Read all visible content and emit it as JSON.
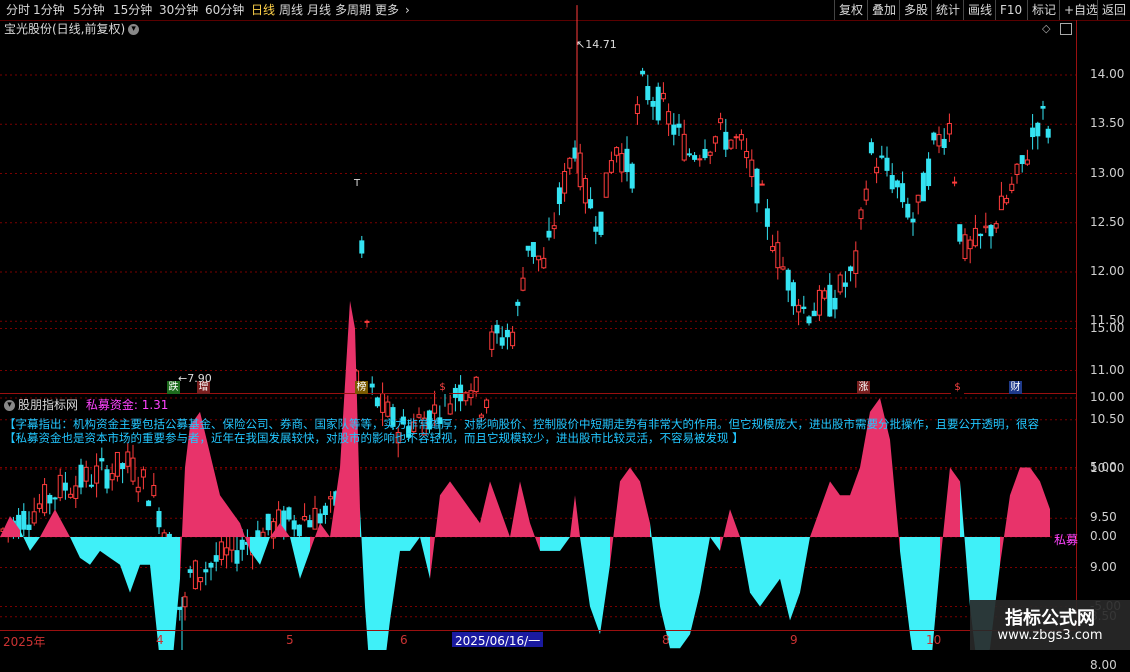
{
  "toolbar": {
    "periods": [
      "分时",
      "1分钟",
      "5分钟",
      "15分钟",
      "30分钟",
      "60分钟",
      "日线",
      "周线",
      "月线",
      "多周期",
      "更多"
    ],
    "actions": [
      "复权",
      "叠加",
      "多股",
      "统计",
      "画线",
      "F10",
      "标记",
      "+自选",
      "返回"
    ]
  },
  "main": {
    "title": "宝光股份(日线,前复权)",
    "high_label": "14.71",
    "low_label": "7.90",
    "marker_t": "T"
  },
  "price_axis": [
    "14.00",
    "13.50",
    "13.00",
    "12.50",
    "12.00",
    "11.50",
    "11.00",
    "10.50",
    "10.00",
    "9.50",
    "9.00",
    "8.50",
    "8.00"
  ],
  "events": [
    {
      "text": "跌",
      "color": "#1d6b1d"
    },
    {
      "text": "增",
      "color": "#7a1f1f"
    },
    {
      "text": "榜",
      "color": "#7a5a00"
    },
    {
      "text": "$",
      "color": "#000000"
    },
    {
      "text": "涨",
      "color": "#7a1f1f"
    },
    {
      "text": "$",
      "color": "#000000"
    },
    {
      "text": "财",
      "color": "#1f3a8a"
    }
  ],
  "indicator": {
    "name": "股朋指标网",
    "series_label": "私募资金:",
    "series_value": "1.31",
    "desc1": "【字幕指出：机构资金主要包括公募基金、保险公司、券商、国家队等等，实力非常雄厚，对影响股价、控制股价中短期走势有非常大的作用。但它规模庞大，进出股市需要分批操作，且要公开透明，很容",
    "desc2": "【私募资金也是资本市场的重要参与者，近年在我国发展较快，对股市的影响也不容轻视，而且它规模较少，进出股市比较灵活，不容易被发现 】",
    "axis": [
      "15.00",
      "10.00",
      "5.00",
      "0.00",
      "-5.00"
    ],
    "end_label": "私募"
  },
  "xaxis": {
    "labels": [
      "2025年",
      "4",
      "5",
      "6",
      "8",
      "9",
      "10"
    ],
    "selected": "2025/06/16/一"
  },
  "watermark": {
    "line1": "指标公式网",
    "line2": "www.zbgs3.com"
  },
  "colors": {
    "up": "#ff3c3c",
    "down": "#34e3f2",
    "fill_pos": "#e8336a",
    "fill_neg": "#3ff0f8",
    "grid": "#7a0000"
  },
  "chart_data": {
    "type": "line",
    "series": [
      {
        "name": "私募",
        "x": [
          0,
          10,
          20,
          30,
          40,
          55,
          70,
          80,
          90,
          100,
          110,
          120,
          130,
          140,
          150,
          160,
          170,
          180,
          185,
          190,
          200,
          210,
          220,
          230,
          240,
          250,
          260,
          270,
          280,
          290,
          300,
          310,
          320,
          330,
          340,
          350,
          355,
          360,
          365,
          370,
          380,
          390,
          400,
          410,
          420,
          430,
          440,
          450,
          460,
          470,
          480,
          490,
          500,
          510,
          520,
          530,
          540,
          550,
          560,
          570,
          575,
          580,
          590,
          600,
          610,
          620,
          630,
          640,
          650,
          660,
          670,
          680,
          690,
          700,
          710,
          720,
          730,
          740,
          750,
          760,
          770,
          780,
          790,
          800,
          810,
          820,
          830,
          840,
          850,
          860,
          870,
          880,
          890,
          900,
          910,
          920,
          930,
          940,
          950,
          960,
          970,
          980,
          990,
          1000,
          1010,
          1020,
          1030,
          1040,
          1050
        ],
        "values": [
          0,
          1.5,
          0.5,
          -1,
          0,
          2,
          0,
          -1.5,
          -2,
          -1,
          -1.5,
          -2,
          -4,
          -2,
          -2,
          -9,
          -11,
          -3,
          5,
          8,
          9,
          6,
          3,
          2,
          1,
          -1,
          -2,
          0,
          1,
          0,
          -3,
          -1,
          1,
          0,
          5,
          17,
          15,
          2,
          -5,
          -10,
          -12,
          -6,
          -1,
          -1,
          0,
          -3,
          3,
          4,
          3,
          2,
          1,
          4,
          2,
          0,
          4,
          1,
          -1,
          -1,
          -1,
          0,
          3,
          0,
          -5,
          -7,
          -2,
          4,
          5,
          4,
          1,
          -5,
          -8,
          -8,
          -7,
          -4,
          0,
          -1,
          2,
          0,
          -4,
          -5,
          -4,
          -3,
          -6,
          -4,
          0,
          2,
          4,
          3,
          3,
          5,
          9,
          10,
          7,
          -1,
          -7,
          -12,
          -10,
          -2,
          5,
          4,
          -5,
          -11,
          -8,
          -2,
          3,
          5,
          5,
          4,
          2
        ]
      }
    ],
    "ylim": [
      -8,
      18
    ]
  }
}
